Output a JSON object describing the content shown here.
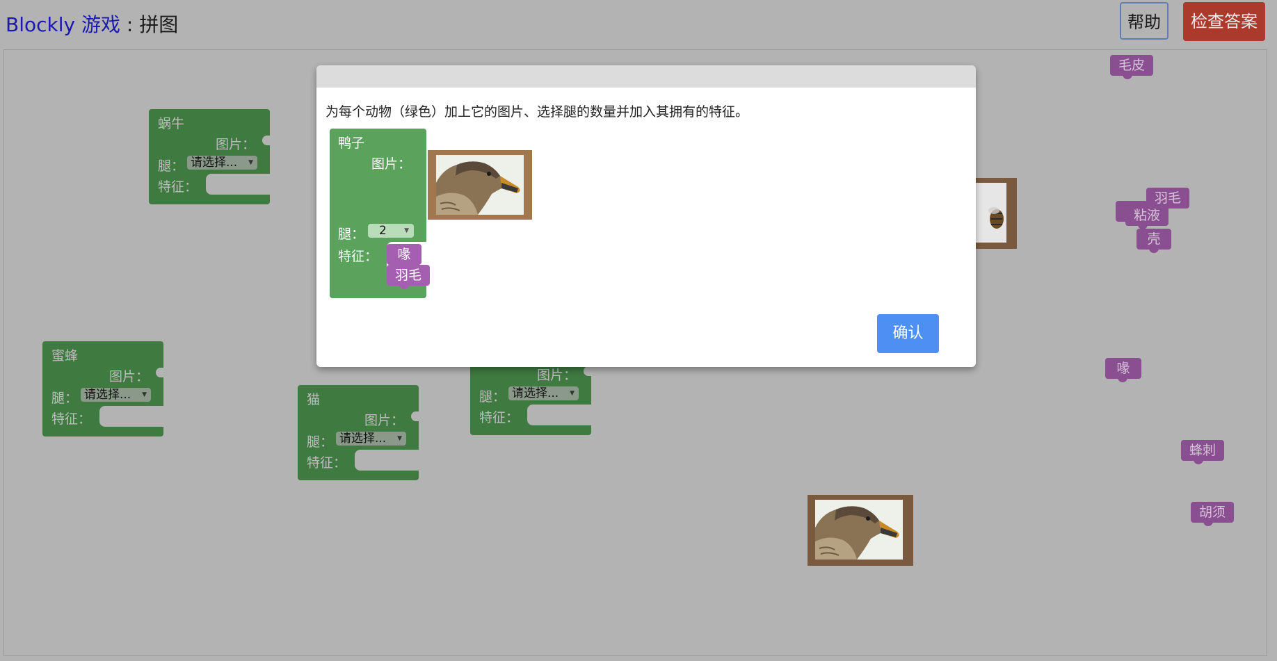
{
  "header": {
    "brand": "Blockly 游戏",
    "separator": " : ",
    "page": "拼图",
    "help_label": "帮助",
    "check_label": "检查答案"
  },
  "labels": {
    "picture": "图片：",
    "legs": "腿：",
    "traits": "特征："
  },
  "animals": [
    {
      "name": "蜗牛",
      "legs": "请选择..."
    },
    {
      "name": "蜜蜂",
      "legs": "请选择..."
    },
    {
      "name": "猫",
      "legs": "请选择..."
    },
    {
      "name": "",
      "legs": "请选择..."
    }
  ],
  "traits": {
    "fur": "毛皮",
    "feathers": "羽毛",
    "slime": "粘液",
    "shell": "壳",
    "beak": "喙",
    "stinger": "蜂刺",
    "whiskers": "胡须"
  },
  "dialog": {
    "instruction": "为每个动物（绿色）加上它的图片、选择腿的数量并加入其拥有的特征。",
    "example": {
      "name": "鸭子",
      "legs": "2",
      "traits": [
        "喙",
        "羽毛"
      ]
    },
    "confirm_label": "确认"
  },
  "icons": {
    "dropdown": "dropdown-caret-icon"
  },
  "colors": {
    "background": "#b3b3b3",
    "animal_block_dim": "#3f7a41",
    "animal_block": "#5ba25d",
    "trait_block_dim": "#8a4f90",
    "trait_block": "#a55fb0",
    "check_button": "#ab3a2c",
    "confirm_button": "#4d8ff2"
  }
}
